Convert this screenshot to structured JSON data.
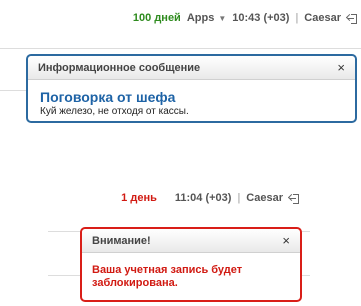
{
  "screen1": {
    "topbar": {
      "days": "100 дней",
      "apps_label": "Apps",
      "time": "10:43 (+03)",
      "separator": "|",
      "user": "Caesar"
    },
    "dialog": {
      "header": "Информационное сообщение",
      "close": "×",
      "title": "Поговорка от шефа",
      "text": "Куй железо, не отходя от кассы."
    }
  },
  "screen2": {
    "topbar": {
      "days": "1 день",
      "time": "11:04 (+03)",
      "separator": "|",
      "user": "Caesar"
    },
    "dialog": {
      "header": "Внимание!",
      "close": "×",
      "text": "Ваша учетная запись будет заблокирована."
    }
  },
  "colors": {
    "green": "#2e8b1e",
    "red": "#d11a12",
    "info_border": "#2c6aa0",
    "warn_border": "#d91e18"
  }
}
